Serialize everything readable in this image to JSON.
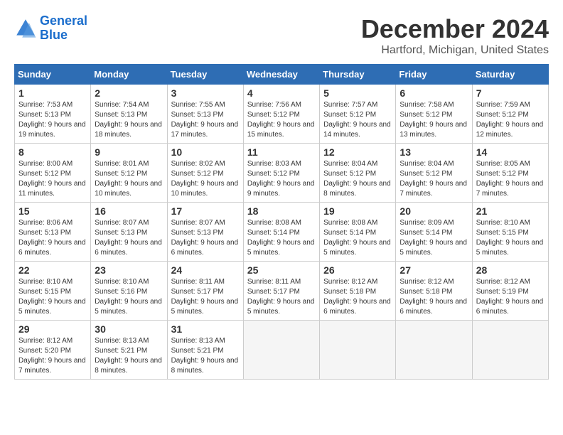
{
  "header": {
    "logo_line1": "General",
    "logo_line2": "Blue",
    "month_title": "December 2024",
    "location": "Hartford, Michigan, United States"
  },
  "weekdays": [
    "Sunday",
    "Monday",
    "Tuesday",
    "Wednesday",
    "Thursday",
    "Friday",
    "Saturday"
  ],
  "weeks": [
    [
      {
        "day": "1",
        "sunrise": "7:53 AM",
        "sunset": "5:13 PM",
        "daylight": "9 hours and 19 minutes."
      },
      {
        "day": "2",
        "sunrise": "7:54 AM",
        "sunset": "5:13 PM",
        "daylight": "9 hours and 18 minutes."
      },
      {
        "day": "3",
        "sunrise": "7:55 AM",
        "sunset": "5:13 PM",
        "daylight": "9 hours and 17 minutes."
      },
      {
        "day": "4",
        "sunrise": "7:56 AM",
        "sunset": "5:12 PM",
        "daylight": "9 hours and 15 minutes."
      },
      {
        "day": "5",
        "sunrise": "7:57 AM",
        "sunset": "5:12 PM",
        "daylight": "9 hours and 14 minutes."
      },
      {
        "day": "6",
        "sunrise": "7:58 AM",
        "sunset": "5:12 PM",
        "daylight": "9 hours and 13 minutes."
      },
      {
        "day": "7",
        "sunrise": "7:59 AM",
        "sunset": "5:12 PM",
        "daylight": "9 hours and 12 minutes."
      }
    ],
    [
      {
        "day": "8",
        "sunrise": "8:00 AM",
        "sunset": "5:12 PM",
        "daylight": "9 hours and 11 minutes."
      },
      {
        "day": "9",
        "sunrise": "8:01 AM",
        "sunset": "5:12 PM",
        "daylight": "9 hours and 10 minutes."
      },
      {
        "day": "10",
        "sunrise": "8:02 AM",
        "sunset": "5:12 PM",
        "daylight": "9 hours and 10 minutes."
      },
      {
        "day": "11",
        "sunrise": "8:03 AM",
        "sunset": "5:12 PM",
        "daylight": "9 hours and 9 minutes."
      },
      {
        "day": "12",
        "sunrise": "8:04 AM",
        "sunset": "5:12 PM",
        "daylight": "9 hours and 8 minutes."
      },
      {
        "day": "13",
        "sunrise": "8:04 AM",
        "sunset": "5:12 PM",
        "daylight": "9 hours and 7 minutes."
      },
      {
        "day": "14",
        "sunrise": "8:05 AM",
        "sunset": "5:12 PM",
        "daylight": "9 hours and 7 minutes."
      }
    ],
    [
      {
        "day": "15",
        "sunrise": "8:06 AM",
        "sunset": "5:13 PM",
        "daylight": "9 hours and 6 minutes."
      },
      {
        "day": "16",
        "sunrise": "8:07 AM",
        "sunset": "5:13 PM",
        "daylight": "9 hours and 6 minutes."
      },
      {
        "day": "17",
        "sunrise": "8:07 AM",
        "sunset": "5:13 PM",
        "daylight": "9 hours and 6 minutes."
      },
      {
        "day": "18",
        "sunrise": "8:08 AM",
        "sunset": "5:14 PM",
        "daylight": "9 hours and 5 minutes."
      },
      {
        "day": "19",
        "sunrise": "8:08 AM",
        "sunset": "5:14 PM",
        "daylight": "9 hours and 5 minutes."
      },
      {
        "day": "20",
        "sunrise": "8:09 AM",
        "sunset": "5:14 PM",
        "daylight": "9 hours and 5 minutes."
      },
      {
        "day": "21",
        "sunrise": "8:10 AM",
        "sunset": "5:15 PM",
        "daylight": "9 hours and 5 minutes."
      }
    ],
    [
      {
        "day": "22",
        "sunrise": "8:10 AM",
        "sunset": "5:15 PM",
        "daylight": "9 hours and 5 minutes."
      },
      {
        "day": "23",
        "sunrise": "8:10 AM",
        "sunset": "5:16 PM",
        "daylight": "9 hours and 5 minutes."
      },
      {
        "day": "24",
        "sunrise": "8:11 AM",
        "sunset": "5:17 PM",
        "daylight": "9 hours and 5 minutes."
      },
      {
        "day": "25",
        "sunrise": "8:11 AM",
        "sunset": "5:17 PM",
        "daylight": "9 hours and 5 minutes."
      },
      {
        "day": "26",
        "sunrise": "8:12 AM",
        "sunset": "5:18 PM",
        "daylight": "9 hours and 6 minutes."
      },
      {
        "day": "27",
        "sunrise": "8:12 AM",
        "sunset": "5:18 PM",
        "daylight": "9 hours and 6 minutes."
      },
      {
        "day": "28",
        "sunrise": "8:12 AM",
        "sunset": "5:19 PM",
        "daylight": "9 hours and 6 minutes."
      }
    ],
    [
      {
        "day": "29",
        "sunrise": "8:12 AM",
        "sunset": "5:20 PM",
        "daylight": "9 hours and 7 minutes."
      },
      {
        "day": "30",
        "sunrise": "8:13 AM",
        "sunset": "5:21 PM",
        "daylight": "9 hours and 8 minutes."
      },
      {
        "day": "31",
        "sunrise": "8:13 AM",
        "sunset": "5:21 PM",
        "daylight": "9 hours and 8 minutes."
      },
      null,
      null,
      null,
      null
    ]
  ]
}
